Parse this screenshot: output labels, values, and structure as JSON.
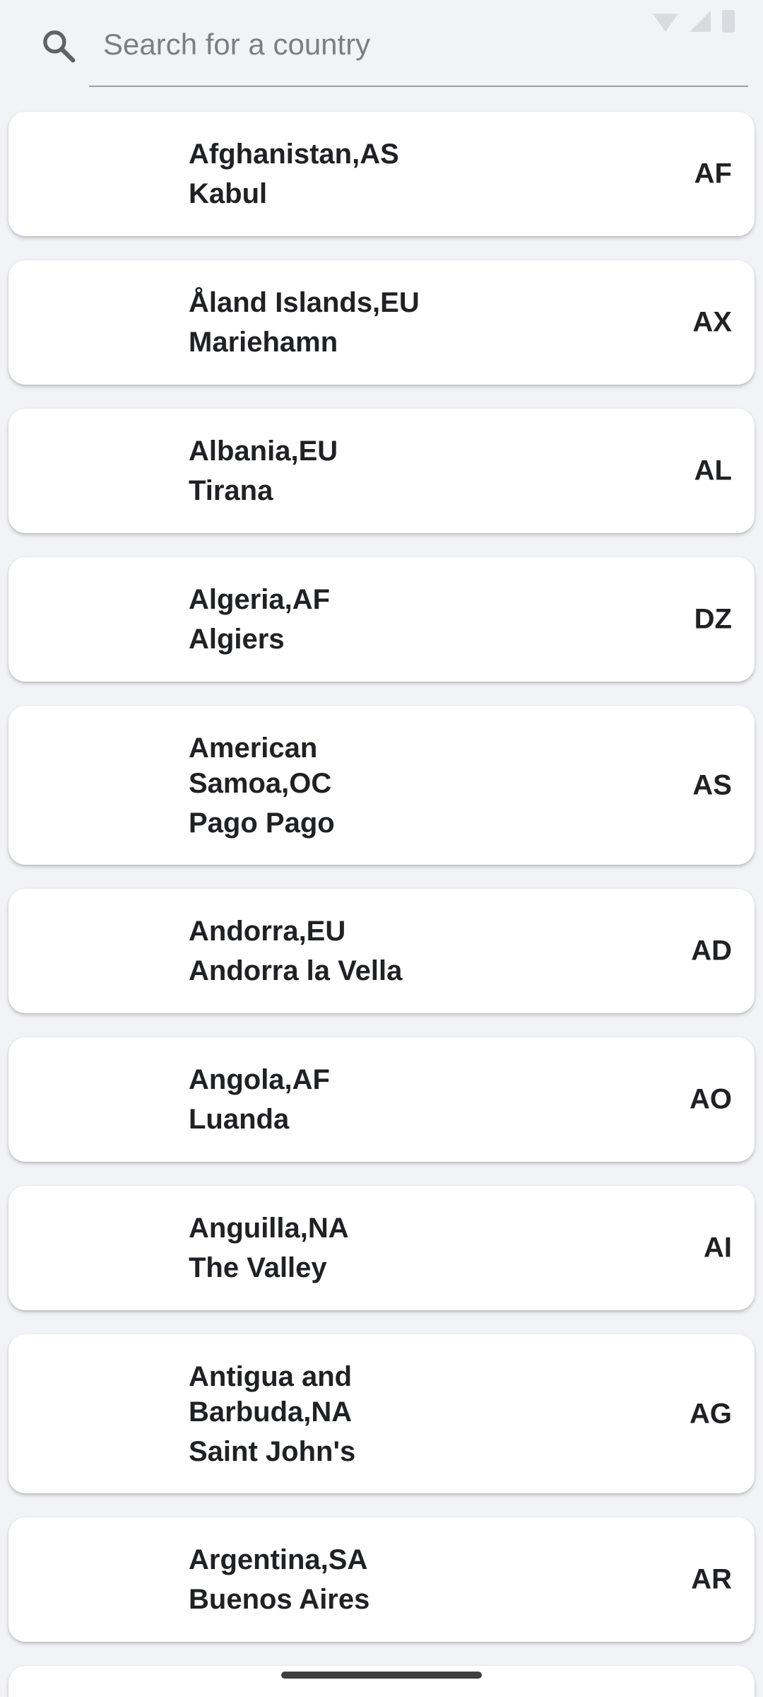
{
  "search": {
    "placeholder": "Search for a country"
  },
  "icons": {
    "search": "search-icon"
  },
  "countries": [
    {
      "name": "Afghanistan,AS",
      "capital": "Kabul",
      "code": "AF"
    },
    {
      "name": "Åland Islands,EU",
      "capital": "Mariehamn",
      "code": "AX"
    },
    {
      "name": "Albania,EU",
      "capital": "Tirana",
      "code": "AL"
    },
    {
      "name": "Algeria,AF",
      "capital": "Algiers",
      "code": "DZ"
    },
    {
      "name": "American Samoa,OC",
      "capital": "Pago Pago",
      "code": "AS"
    },
    {
      "name": "Andorra,EU",
      "capital": "Andorra la Vella",
      "code": "AD"
    },
    {
      "name": "Angola,AF",
      "capital": "Luanda",
      "code": "AO"
    },
    {
      "name": "Anguilla,NA",
      "capital": "The Valley",
      "code": "AI"
    },
    {
      "name": "Antigua and Barbuda,NA",
      "capital": "Saint John's",
      "code": "AG"
    },
    {
      "name": "Argentina,SA",
      "capital": "Buenos Aires",
      "code": "AR"
    },
    {
      "name": "",
      "capital": "",
      "code": ""
    }
  ],
  "colors": {
    "background": "#f2f3f7",
    "card": "#ffffff",
    "text": "#202124"
  }
}
